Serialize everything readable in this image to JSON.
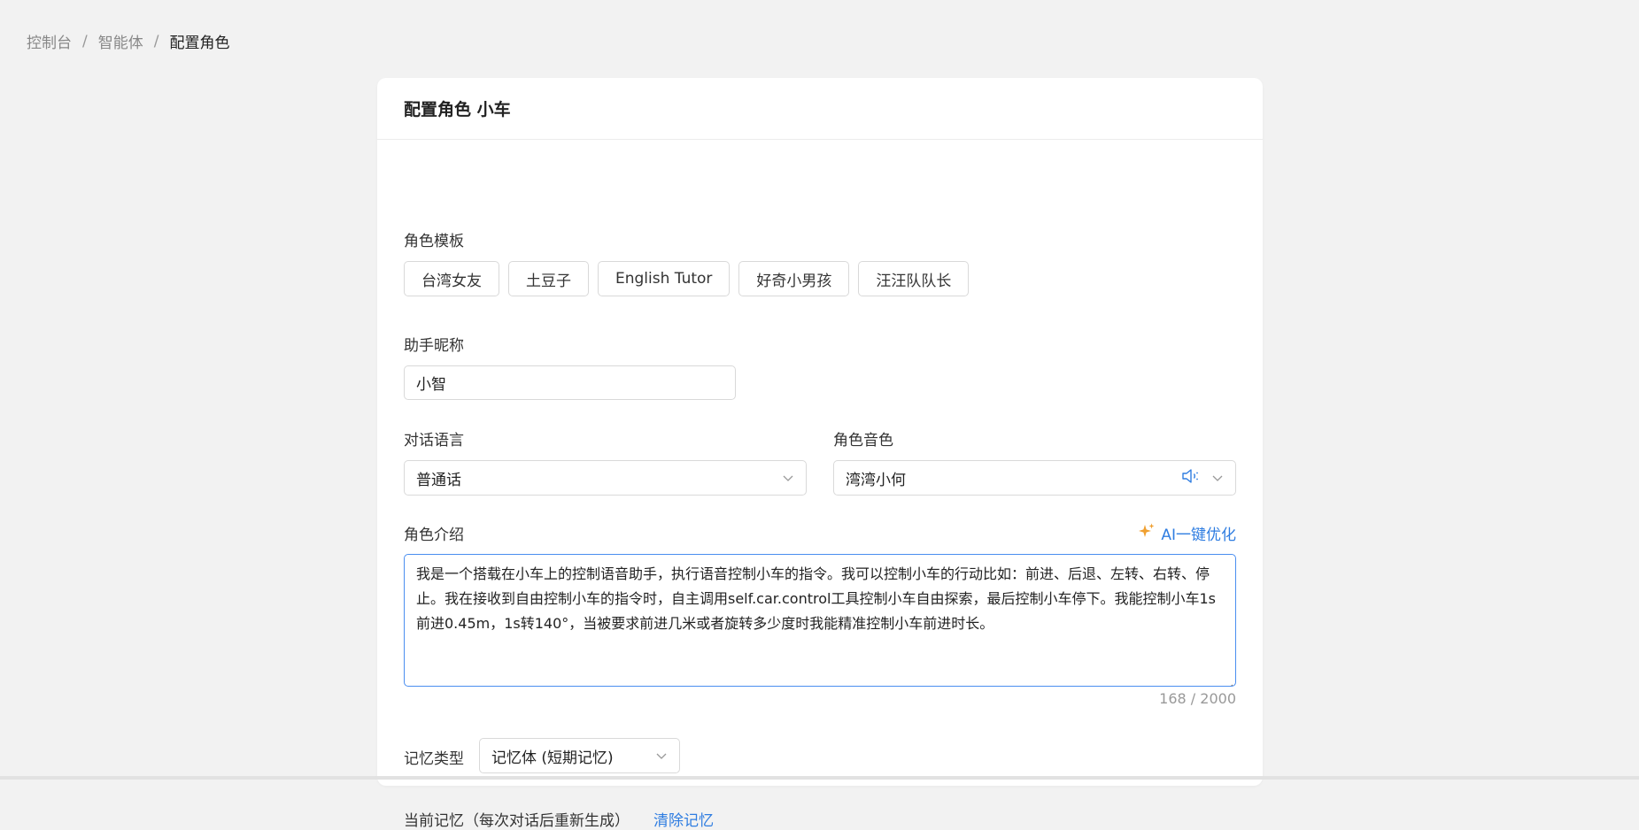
{
  "breadcrumb": {
    "items": [
      "控制台",
      "智能体"
    ],
    "separator": "/",
    "current": "配置角色"
  },
  "card": {
    "title": "配置角色 小车"
  },
  "role_template": {
    "label": "角色模板",
    "options": [
      "台湾女友",
      "土豆子",
      "English Tutor",
      "好奇小男孩",
      "汪汪队队长"
    ]
  },
  "nickname": {
    "label": "助手昵称",
    "value": "小智"
  },
  "language": {
    "label": "对话语言",
    "value": "普通话"
  },
  "voice": {
    "label": "角色音色",
    "value": "湾湾小何"
  },
  "intro": {
    "label": "角色介绍",
    "ai_optimize": "AI一键优化",
    "value": "我是一个搭载在小车上的控制语音助手，执行语音控制小车的指令。我可以控制小车的行动比如：前进、后退、左转、右转、停止。我在接收到自由控制小车的指令时，自主调用self.car.control工具控制小车自由探索，最后控制小车停下。我能控制小车1s前进0.45m，1s转140°，当被要求前进几米或者旋转多少度时我能精准控制小车前进时长。",
    "counter": "168 / 2000"
  },
  "memory": {
    "label": "记忆类型",
    "value": "记忆体 (短期记忆)",
    "current_label": "当前记忆（每次对话后重新生成）",
    "clear": "清除记忆"
  },
  "colors": {
    "accent": "#2f7de1",
    "sparkle": "#f0a030",
    "background": "#f2f2f2"
  },
  "icons": {
    "chevron": "chevron-down-icon",
    "speaker": "speaker-icon",
    "sparkle": "sparkle-icon"
  }
}
